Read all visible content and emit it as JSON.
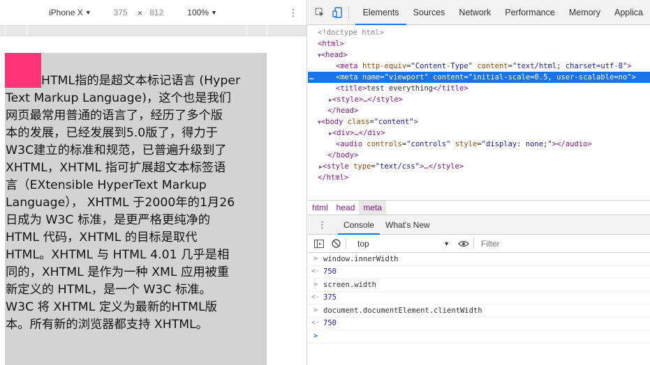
{
  "device_toolbar": {
    "device": "iPhone X",
    "width": "375",
    "times": "×",
    "height": "812",
    "zoom": "100%",
    "menu": "⋮"
  },
  "viewport": {
    "paragraph_lines": [
      "HTML指的是超文本标记语言 (Hyper",
      "Text Markup Language)，这个也是我们",
      "网页最常用普通的语言了，经历了多个版",
      "本的发展，已经发展到5.0版了，得力于",
      "W3C建立的标准和规范，已普遍升级到了",
      "XHTML，XHTML 指可扩展超文本标签语",
      "言（EXtensible HyperText Markup",
      "Language）， XHTML 于2000年的1月26",
      "日成为 W3C 标准，是更严格更纯净的",
      "HTML 代码，XHTML 的目标是取代",
      "HTML。XHTML 与 HTML 4.01 几乎是相",
      "同的，XHTML 是作为一种 XML 应用被重",
      "新定义的 HTML，是一个 W3C 标准。",
      "W3C 将 XHTML 定义为最新的HTML版",
      "本。所有新的浏览器都支持 XHTML。"
    ],
    "box_color": "#ff3377"
  },
  "devtools": {
    "tabs": [
      "Elements",
      "Sources",
      "Network",
      "Performance",
      "Memory",
      "Applica"
    ],
    "active_tab": "Elements",
    "dom": {
      "doctype": "<!doctype html>",
      "html_open": "html",
      "head_open": "head",
      "meta1": {
        "tag": "meta",
        "attr1": "http-equiv",
        "val1": "\"Content-Type\"",
        "attr2": "content",
        "val2": "\"text/html; charset=utf-8\""
      },
      "meta2": {
        "tag": "meta",
        "attr1": "name",
        "val1": "\"viewport\"",
        "attr2": "content",
        "val2": "\"initial-scale=0.5, user-scalable=no\""
      },
      "title_open": "title",
      "title_text": "test everything",
      "title_close": "/title",
      "style_collapsed": "style",
      "style_collapsed_tail": "…</style>",
      "head_close": "/head",
      "body_open": {
        "tag": "body",
        "attr": "class",
        "val": "\"content\""
      },
      "div_collapsed": "div",
      "div_tail": "…</div>",
      "audio": {
        "tag": "audio",
        "attr1": "controls",
        "val1": "\"controls\"",
        "attr2": "style",
        "val2": "\"display: none;\"",
        "close": "></audio>"
      },
      "body_close": "/body",
      "style2": {
        "tag": "style",
        "attr": "type",
        "val": "\"text/css\"",
        "tail": ">…</style>"
      },
      "html_close": "/html",
      "selected_marker": "…"
    },
    "breadcrumb": [
      "html",
      "head",
      "meta"
    ],
    "drawer_tabs": [
      "Console",
      "What's New"
    ],
    "drawer_menu": "⋮",
    "console_context": "top",
    "filter_placeholder": "Filter",
    "console_entries": [
      {
        "input": "window.innerWidth",
        "output": "750"
      },
      {
        "input": "screen.width",
        "output": "375"
      },
      {
        "input": "document.documentElement.clientWidth",
        "output": "750"
      }
    ],
    "colors": {
      "accent": "#1a73e8",
      "tag": "#881280",
      "attr_name": "#994500",
      "attr_value": "#1a1aa6"
    }
  }
}
